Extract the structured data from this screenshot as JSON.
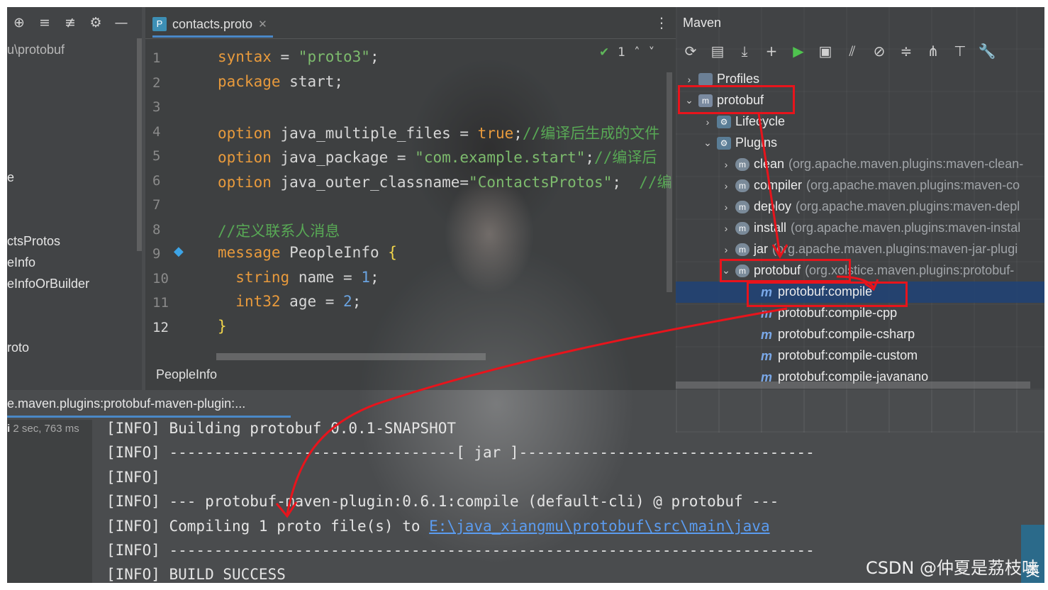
{
  "project": {
    "path": "u\\protobuf",
    "items": [
      "e",
      "ctsProtos",
      "eInfo",
      "eInfoOrBuilder",
      "roto"
    ]
  },
  "editor": {
    "tab_icon_letter": "P",
    "tab_label": "contacts.proto",
    "inspection_count": "1",
    "line_numbers": [
      "1",
      "2",
      "3",
      "4",
      "5",
      "6",
      "7",
      "8",
      "9",
      "10",
      "11",
      "12"
    ],
    "breadcrumb": "PeopleInfo"
  },
  "code": {
    "l1": {
      "kw": "syntax",
      "val": "\"proto3\"",
      "end": ";"
    },
    "l2": {
      "kw": "package",
      "rest": "start;"
    },
    "l4": {
      "kw": "option",
      "name": "java_multiple_files",
      "val": "true",
      "comment": "//编译后生成的文件"
    },
    "l5": {
      "kw": "option",
      "name": "java_package",
      "val": "\"com.example.start\"",
      "comment": "//编译后"
    },
    "l6": {
      "kw": "option",
      "name": "java_outer_classname",
      "val": "\"ContactsProtos\"",
      "comment": "//编"
    },
    "l8": {
      "comment": "//定义联系人消息"
    },
    "l9": {
      "kw": "message",
      "name": "PeopleInfo",
      "brace": "{"
    },
    "l10": {
      "type": "string",
      "name": "name",
      "num": "1"
    },
    "l11": {
      "type": "int32",
      "name": "age",
      "num": "2"
    },
    "l12": {
      "brace": "}"
    }
  },
  "maven": {
    "title": "Maven",
    "tree": {
      "profiles": "Profiles",
      "project": "protobuf",
      "lifecycle": "Lifecycle",
      "plugins": "Plugins"
    },
    "plugins": [
      {
        "name": "clean",
        "meta": "(org.apache.maven.plugins:maven-clean-"
      },
      {
        "name": "compiler",
        "meta": "(org.apache.maven.plugins:maven-co"
      },
      {
        "name": "deploy",
        "meta": "(org.apache.maven.plugins:maven-depl"
      },
      {
        "name": "install",
        "meta": "(org.apache.maven.plugins:maven-instal"
      },
      {
        "name": "jar",
        "meta": "(org.apache.maven.plugins:maven-jar-plugi"
      },
      {
        "name": "protobuf",
        "meta": "(org.xolstice.maven.plugins:protobuf-"
      }
    ],
    "goals": [
      "protobuf:compile",
      "protobuf:compile-cpp",
      "protobuf:compile-csharp",
      "protobuf:compile-custom",
      "protobuf:compile-javanano"
    ]
  },
  "run": {
    "tab_label": "e.maven.plugins:protobuf-maven-plugin:...",
    "time_prefix": "i",
    "duration": "2 sec, 763 ms",
    "console": [
      "[INFO] Building protobuf 0.0.1-SNAPSHOT",
      "[INFO] --------------------------------[ jar ]---------------------------------",
      "[INFO]",
      "[INFO] --- protobuf-maven-plugin:0.6.1:compile (default-cli) @ protobuf ---",
      "",
      "[INFO] ------------------------------------------------------------------------",
      "[INFO] BUILD SUCCESS"
    ],
    "console_compile_prefix": "[INFO] Compiling 1 proto file(s) to ",
    "console_compile_link": "E:\\java_xiangmu\\protobuf\\src\\main\\java"
  },
  "overlay": {
    "ime": "英",
    "watermark": "CSDN @仲夏是荔枝味"
  }
}
